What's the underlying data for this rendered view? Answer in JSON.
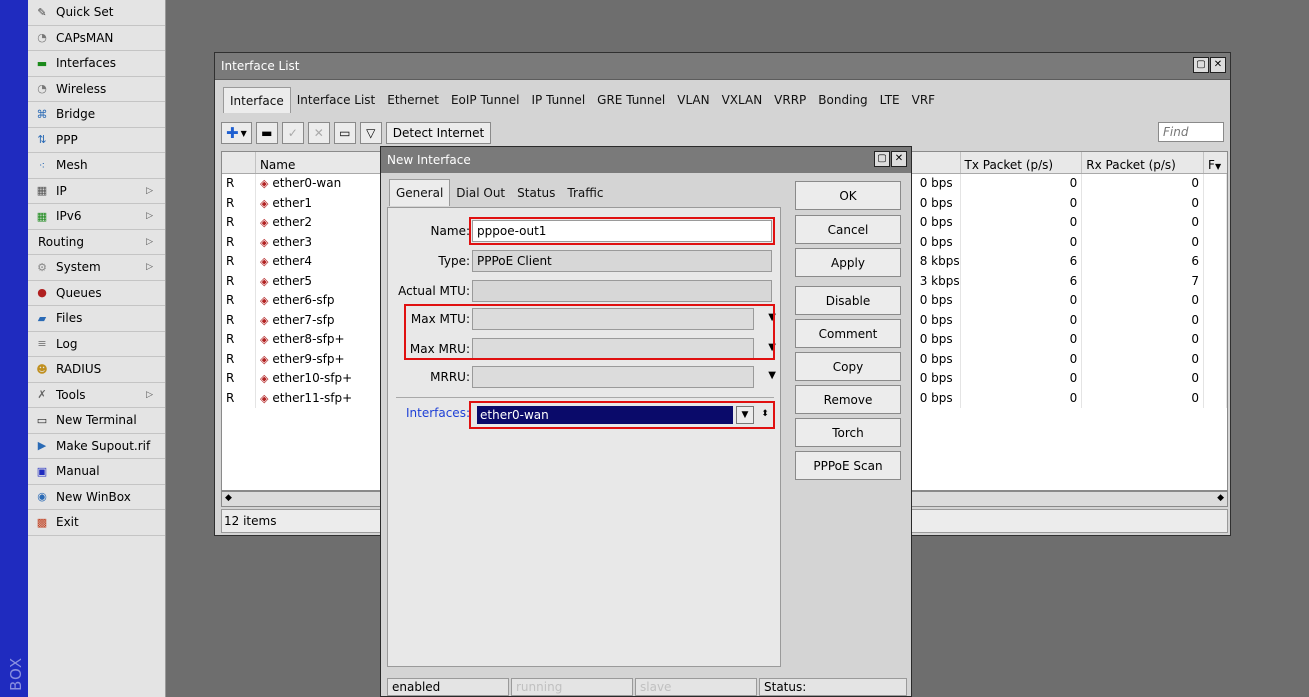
{
  "brand": "BOX",
  "sidebar": {
    "items": [
      {
        "label": "Quick Set",
        "icon": "wand-icon",
        "glyph": "✎",
        "color": "#444",
        "arrow": false
      },
      {
        "label": "CAPsMAN",
        "icon": "antenna-icon",
        "glyph": "◔",
        "color": "#777",
        "arrow": false
      },
      {
        "label": "Interfaces",
        "icon": "interfaces-icon",
        "glyph": "▬",
        "color": "#1a8a1a",
        "arrow": false
      },
      {
        "label": "Wireless",
        "icon": "wireless-icon",
        "glyph": "◔",
        "color": "#777",
        "arrow": false
      },
      {
        "label": "Bridge",
        "icon": "bridge-icon",
        "glyph": "⌘",
        "color": "#2a6ab5",
        "arrow": false
      },
      {
        "label": "PPP",
        "icon": "ppp-icon",
        "glyph": "⇅",
        "color": "#2a6ab5",
        "arrow": false
      },
      {
        "label": "Mesh",
        "icon": "mesh-icon",
        "glyph": "⁖",
        "color": "#2a6ab5",
        "arrow": false
      },
      {
        "label": "IP",
        "icon": "ip-icon",
        "glyph": "▦",
        "color": "#555",
        "arrow": true
      },
      {
        "label": "IPv6",
        "icon": "ipv6-icon",
        "glyph": "▦",
        "color": "#1a8a1a",
        "arrow": true
      },
      {
        "label": "Routing",
        "icon": "",
        "glyph": "",
        "color": "#000",
        "arrow": true
      },
      {
        "label": "System",
        "icon": "system-icon",
        "glyph": "⚙",
        "color": "#888",
        "arrow": true
      },
      {
        "label": "Queues",
        "icon": "queues-icon",
        "glyph": "●",
        "color": "#b02020",
        "arrow": false
      },
      {
        "label": "Files",
        "icon": "files-icon",
        "glyph": "▰",
        "color": "#2a6ab5",
        "arrow": false
      },
      {
        "label": "Log",
        "icon": "log-icon",
        "glyph": "≡",
        "color": "#777",
        "arrow": false
      },
      {
        "label": "RADIUS",
        "icon": "radius-icon",
        "glyph": "☻",
        "color": "#c09020",
        "arrow": false
      },
      {
        "label": "Tools",
        "icon": "tools-icon",
        "glyph": "✗",
        "color": "#666",
        "arrow": true
      },
      {
        "label": "New Terminal",
        "icon": "terminal-icon",
        "glyph": "▭",
        "color": "#222",
        "arrow": false
      },
      {
        "label": "Make Supout.rif",
        "icon": "supout-icon",
        "glyph": "▶",
        "color": "#2a6ab5",
        "arrow": false
      },
      {
        "label": "Manual",
        "icon": "manual-icon",
        "glyph": "▣",
        "color": "#1f2bbf",
        "arrow": false
      },
      {
        "label": "New WinBox",
        "icon": "winbox-icon",
        "glyph": "◉",
        "color": "#2a6ab5",
        "arrow": false
      },
      {
        "label": "Exit",
        "icon": "exit-icon",
        "glyph": "▩",
        "color": "#c04020",
        "arrow": false
      }
    ]
  },
  "iface_window": {
    "title": "Interface List",
    "tabs": [
      "Interface",
      "Interface List",
      "Ethernet",
      "EoIP Tunnel",
      "IP Tunnel",
      "GRE Tunnel",
      "VLAN",
      "VXLAN",
      "VRRP",
      "Bonding",
      "LTE",
      "VRF"
    ],
    "toolbar": {
      "detect": "Detect Internet",
      "find_placeholder": "Find"
    },
    "columns": [
      "",
      "Name",
      "Tx Packet (p/s)",
      "Rx Packet (p/s)",
      "F"
    ],
    "rows": [
      {
        "flag": "R",
        "name": "ether0-wan",
        "rate": "0 bps",
        "tx": "0",
        "rx": "0"
      },
      {
        "flag": "R",
        "name": "ether1",
        "rate": "0 bps",
        "tx": "0",
        "rx": "0"
      },
      {
        "flag": "R",
        "name": "ether2",
        "rate": "0 bps",
        "tx": "0",
        "rx": "0"
      },
      {
        "flag": "R",
        "name": "ether3",
        "rate": "0 bps",
        "tx": "0",
        "rx": "0"
      },
      {
        "flag": "R",
        "name": "ether4",
        "rate": "8 kbps",
        "tx": "6",
        "rx": "6"
      },
      {
        "flag": "R",
        "name": "ether5",
        "rate": "3 kbps",
        "tx": "6",
        "rx": "7"
      },
      {
        "flag": "R",
        "name": "ether6-sfp",
        "rate": "0 bps",
        "tx": "0",
        "rx": "0"
      },
      {
        "flag": "R",
        "name": "ether7-sfp",
        "rate": "0 bps",
        "tx": "0",
        "rx": "0"
      },
      {
        "flag": "R",
        "name": "ether8-sfp+",
        "rate": "0 bps",
        "tx": "0",
        "rx": "0"
      },
      {
        "flag": "R",
        "name": "ether9-sfp+",
        "rate": "0 bps",
        "tx": "0",
        "rx": "0"
      },
      {
        "flag": "R",
        "name": "ether10-sfp+",
        "rate": "0 bps",
        "tx": "0",
        "rx": "0"
      },
      {
        "flag": "R",
        "name": "ether11-sfp+",
        "rate": "0 bps",
        "tx": "0",
        "rx": "0"
      }
    ],
    "status": "12 items"
  },
  "dialog": {
    "title": "New Interface",
    "tabs": [
      "General",
      "Dial Out",
      "Status",
      "Traffic"
    ],
    "fields": {
      "name_label": "Name:",
      "name_value": "pppoe-out1",
      "type_label": "Type:",
      "type_value": "PPPoE Client",
      "actual_mtu_label": "Actual MTU:",
      "max_mtu_label": "Max MTU:",
      "max_mru_label": "Max MRU:",
      "mrru_label": "MRRU:",
      "interfaces_label": "Interfaces:",
      "interfaces_value": "ether0-wan"
    },
    "buttons": [
      "OK",
      "Cancel",
      "Apply",
      "Disable",
      "Comment",
      "Copy",
      "Remove",
      "Torch",
      "PPPoE Scan"
    ],
    "statusbar": {
      "enabled": "enabled",
      "running": "running",
      "slave": "slave",
      "status": "Status:"
    },
    "highlight_color": "#e01010"
  }
}
